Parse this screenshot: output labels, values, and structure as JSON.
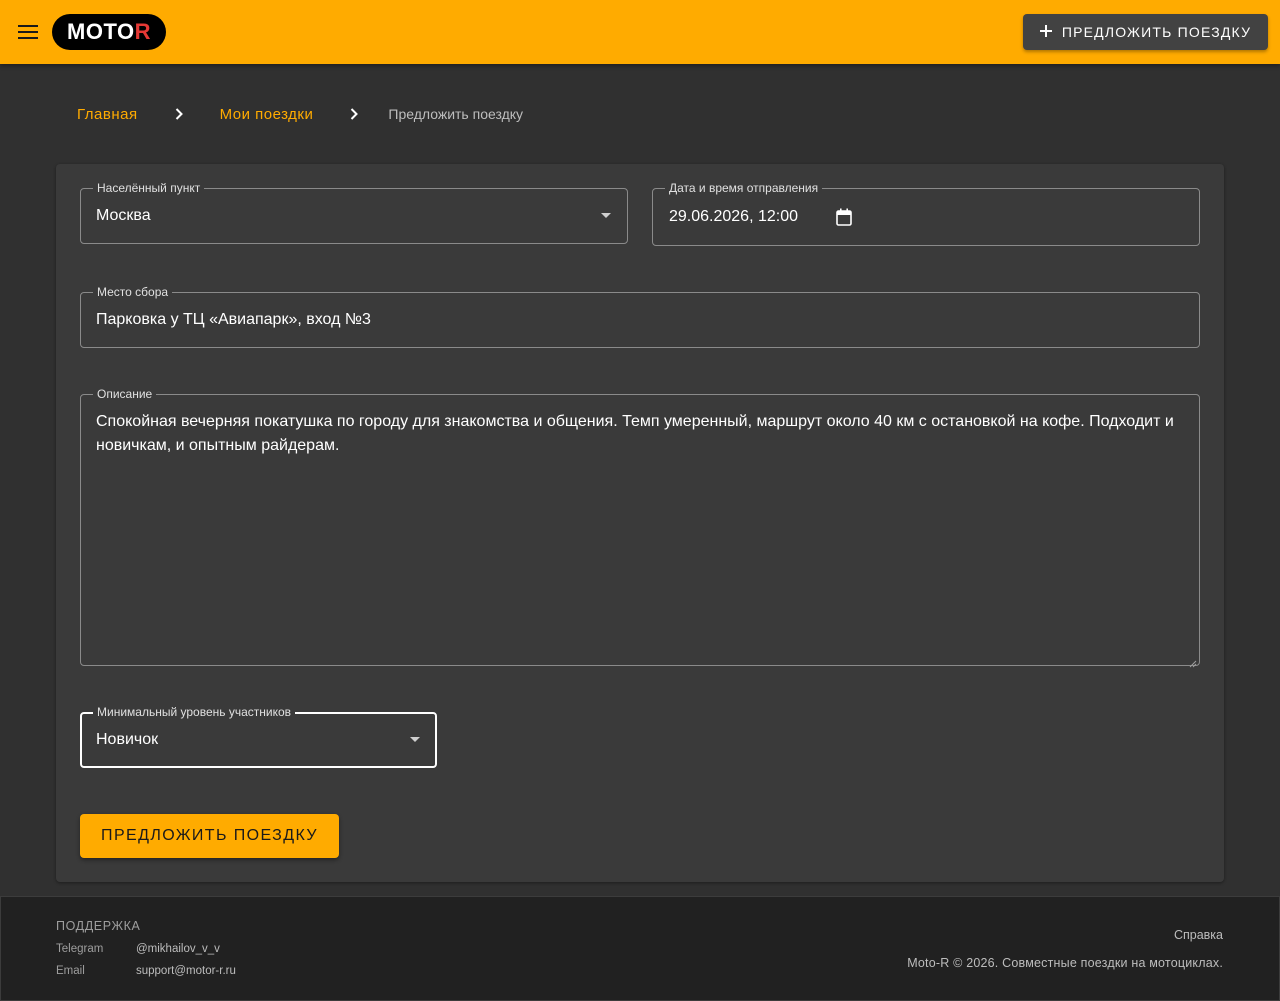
{
  "header": {
    "logo_main": "MOTO",
    "logo_accent": "R",
    "propose_button_label": "ПРЕДЛОЖИТЬ ПОЕЗДКУ",
    "colors": {
      "appbar": "#ffab00",
      "logo_accent": "#e53935"
    },
    "icons": {
      "menu": "menu-icon",
      "add": "plus-icon"
    }
  },
  "breadcrumbs": {
    "items": [
      {
        "label": "Главная"
      },
      {
        "label": "Мои поездки"
      }
    ],
    "current": "Предложить поездку",
    "separator_icon": "chevron-right-icon"
  },
  "form": {
    "city": {
      "label": "Населённый пункт",
      "value": "Москва"
    },
    "datetime": {
      "label": "Дата и время отправления",
      "value": "29.06.2026, 12:00"
    },
    "meeting_point": {
      "label": "Место сбора",
      "value": "Парковка у ТЦ «Авиапарк», вход №3"
    },
    "description": {
      "label": "Описание",
      "value": "Спокойная вечерняя покатушка по городу для знакомства и общения. Темп умеренный, маршрут около 40 км с остановкой на кофе. Подходит и новичкам, и опытным райдерам."
    },
    "min_level": {
      "label": "Минимальный уровень участников",
      "value": "Новичок"
    },
    "submit_label": "ПРЕДЛОЖИТЬ ПОЕЗДКУ"
  },
  "footer": {
    "support_title": "ПОДДЕРЖКА",
    "contacts": [
      {
        "key": "Telegram",
        "value": "@mikhailov_v_v"
      },
      {
        "key": "Email",
        "value": "support@motor-r.ru"
      }
    ],
    "help_link": "Справка",
    "copyright": "Moto-R © 2026. Совместные поездки на мотоциклах."
  }
}
